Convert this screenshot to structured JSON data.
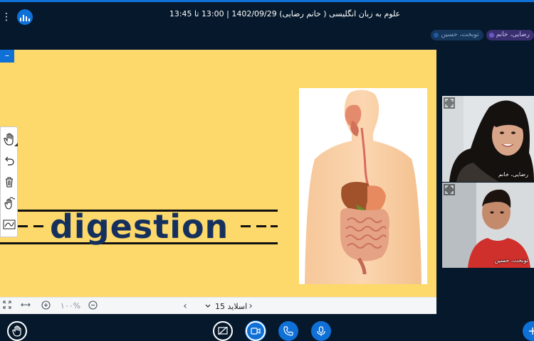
{
  "meeting": {
    "title": "علوم به زبان انگلیسی ( خانم رضایی) 1402/09/29 | 13:00 تا 13:45"
  },
  "talkers": [
    {
      "name": "رضایی، خانم"
    },
    {
      "name": "توبخت، حسین"
    }
  ],
  "slide": {
    "word": "digestion",
    "label": "اسلاید 15",
    "zoom": "۱۰۰%"
  },
  "presentation_toolbar": {
    "fullscreen_icon": "fullscreen-icon",
    "fit_width_icon": "fit-to-width-icon",
    "zoom_in_icon": "zoom-in-icon",
    "zoom_out_icon": "zoom-out-icon"
  },
  "whiteboard_tools": [
    "hand-tool-icon",
    "undo-icon",
    "clear-all-icon",
    "multi-user-icon",
    "line-tool-icon"
  ],
  "webcams": [
    {
      "label": "رضایی، خانم"
    },
    {
      "label": "توبخت، حسین"
    }
  ],
  "actions": [
    "raise-hand",
    "share-screen",
    "camera",
    "phone",
    "microphone",
    "add"
  ],
  "colors": {
    "background": "#06192c",
    "accent": "#0f70d7",
    "slide_background": "#fdd86a",
    "word_color": "#16305e"
  }
}
